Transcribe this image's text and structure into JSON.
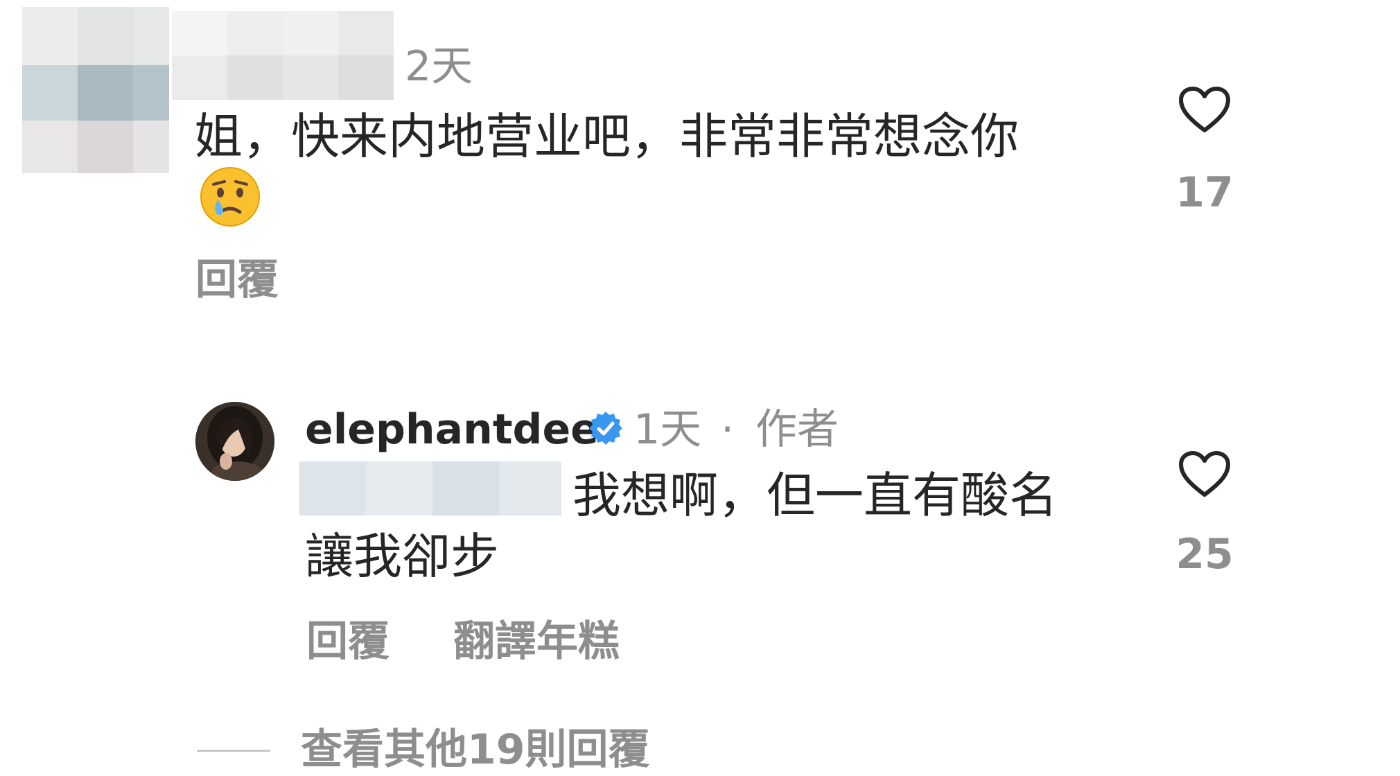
{
  "comment1": {
    "time": "2天",
    "text": "姐，快来内地营业吧，非常非常想念你",
    "emoji": "😢",
    "reply_label": "回覆",
    "like_count": "17",
    "like_icon": "heart-outline-icon"
  },
  "reply1": {
    "username": "elephantdee",
    "verified_icon": "verified-badge-icon",
    "time": "1天",
    "separator": "·",
    "author_label": "作者",
    "text_line1": "我想啊，但一直有酸名",
    "text_line2": "讓我卻步",
    "reply_label": "回覆",
    "translate_label": "翻譯年糕",
    "like_count": "25",
    "like_icon": "heart-outline-icon",
    "avatar_icon": "avatar"
  },
  "view_more": {
    "label": "查看其他19則回覆"
  },
  "colors": {
    "text_primary": "#262626",
    "text_secondary": "#8e8e8e",
    "verified_blue": "#3897f0",
    "divider": "#c7c7c7"
  }
}
